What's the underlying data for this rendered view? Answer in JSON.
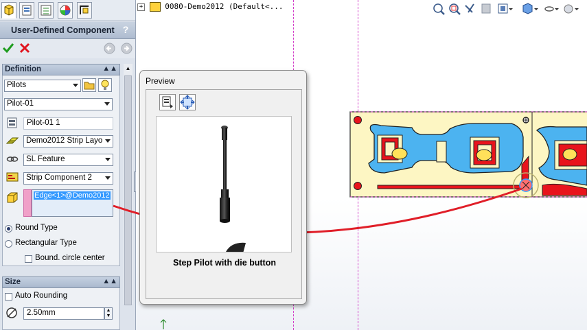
{
  "property_manager": {
    "title": "User-Defined Component",
    "help_label": "?",
    "definition": {
      "header": "Definition",
      "category_value": "Pilots",
      "item_value": "Pilot-01",
      "name_value": "Pilot-01 1",
      "strip_layout_value": "Demo2012 Strip Layo",
      "feature_value": "SL Feature",
      "component_value": "Strip Component 2",
      "edge_value": "Edge<1>@Demo2012",
      "round_type_label": "Round Type",
      "rect_type_label": "Rectangular Type",
      "bound_circle_label": "Bound. circle center"
    },
    "size": {
      "header": "Size",
      "auto_rounding_label": "Auto Rounding",
      "diameter_value": "2.50mm"
    }
  },
  "tree": {
    "label": "0080-Demo2012  (Default<..."
  },
  "preview": {
    "title": "Preview",
    "caption": "Step Pilot with die button"
  },
  "colors": {
    "strip_fill": "#fdf6c3",
    "part_blue": "#4cb3f0",
    "part_red": "#e8141c",
    "selection": "#3399ff",
    "dashed_line": "#d23cc8"
  }
}
